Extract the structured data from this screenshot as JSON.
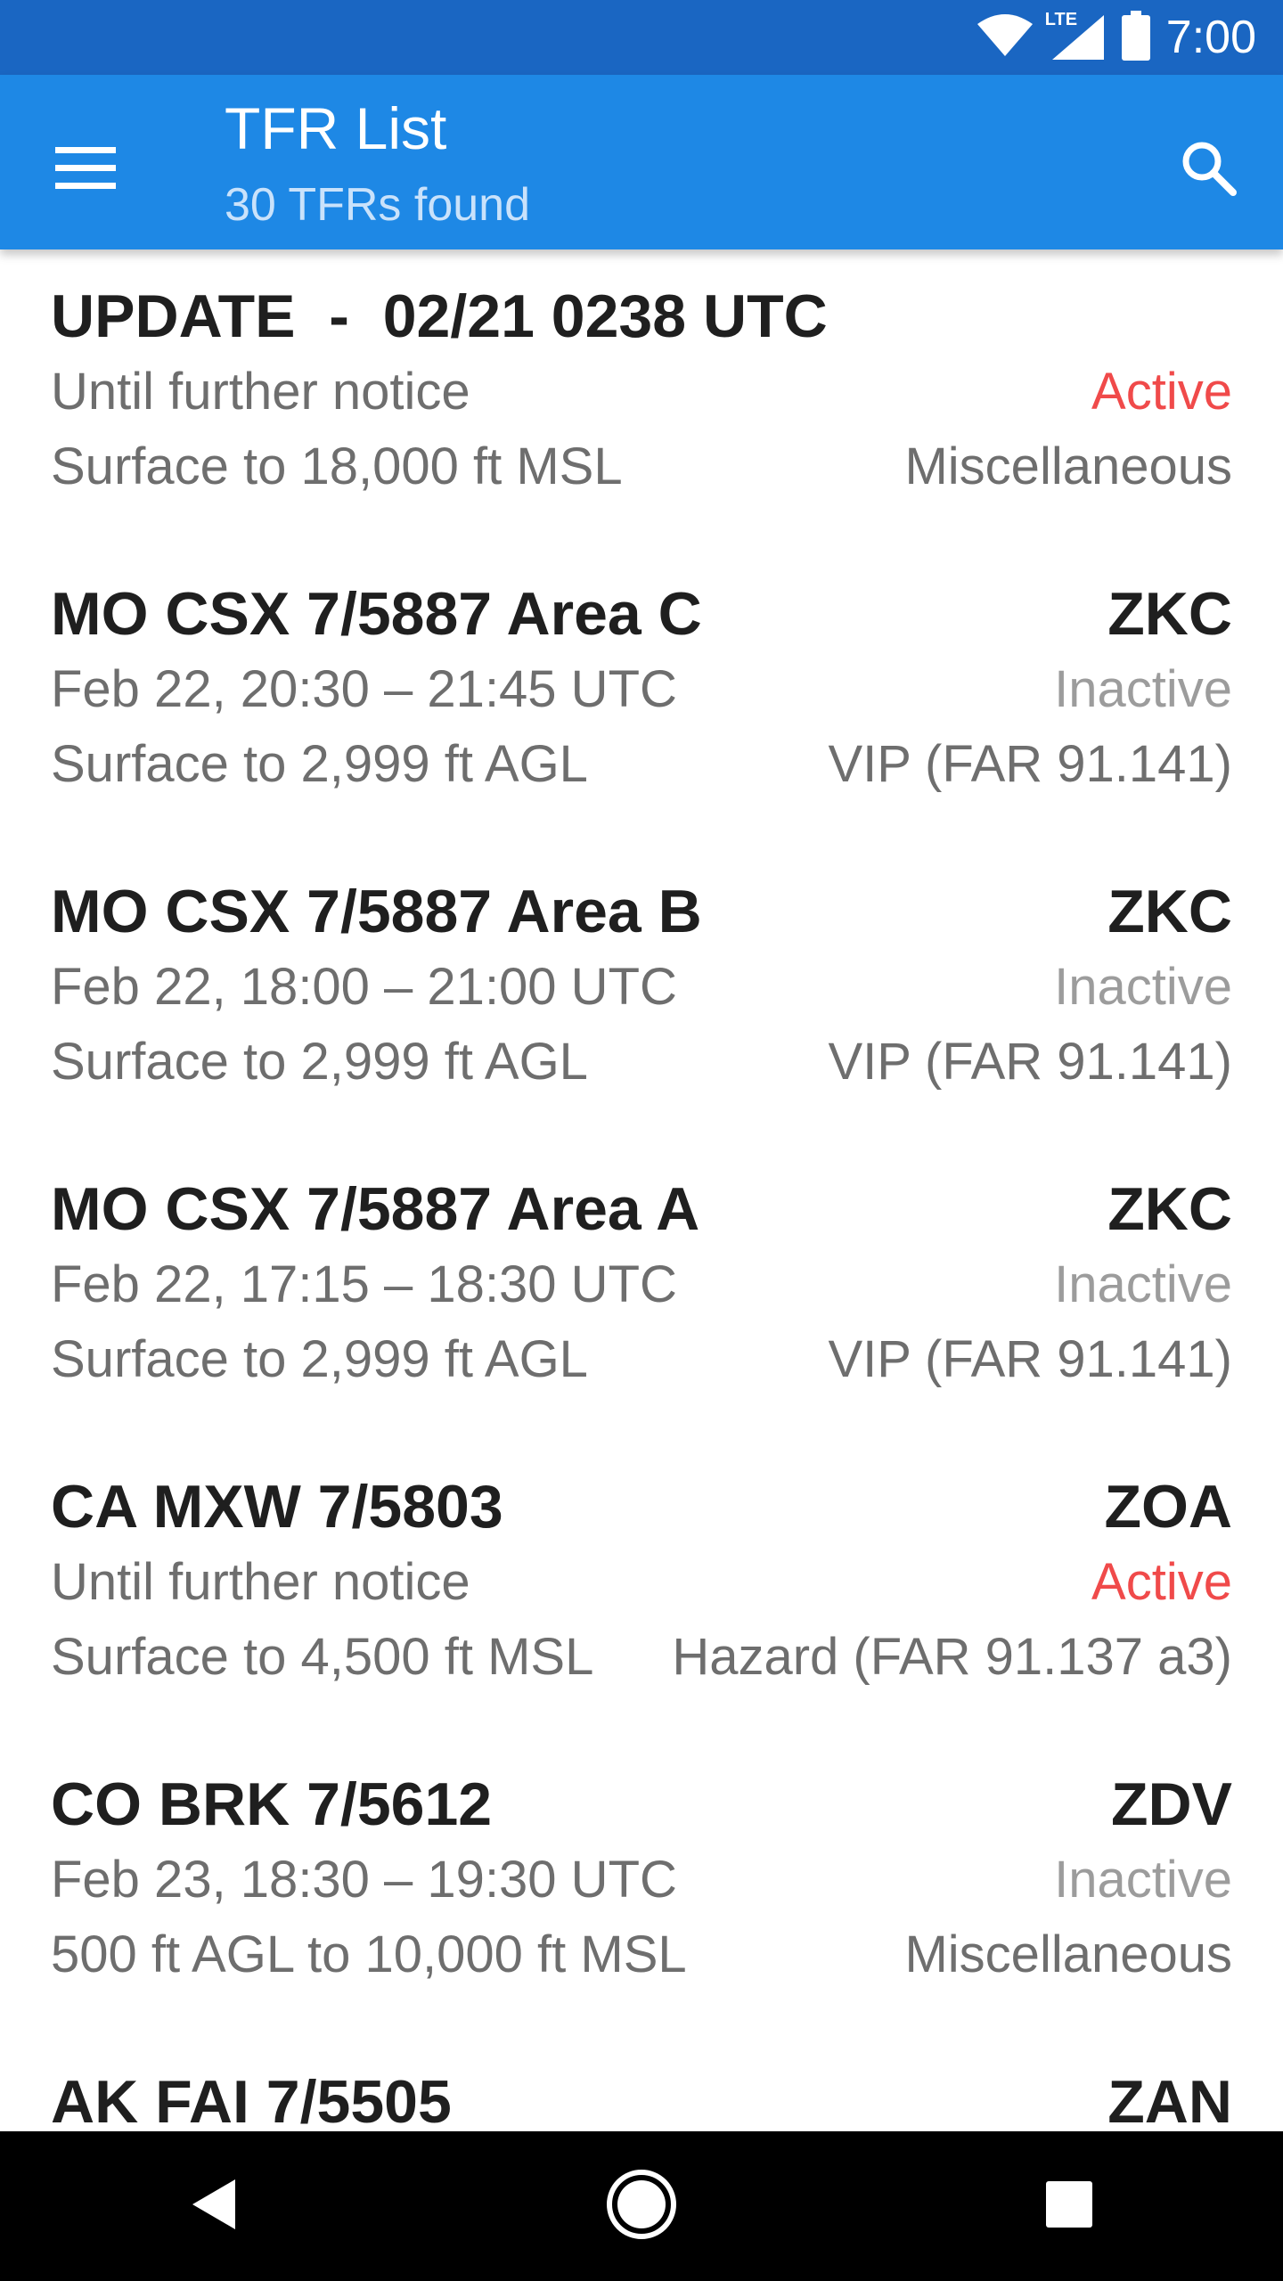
{
  "status_bar": {
    "time": "7:00",
    "network": "LTE",
    "icons": [
      "wifi-icon",
      "cell-signal-icon",
      "battery-icon"
    ]
  },
  "app_bar": {
    "title": "TFR List",
    "subtitle": "30 TFRs found",
    "menu_icon": "hamburger-menu-icon",
    "search_icon": "search-icon"
  },
  "colors": {
    "status_bar": "#1a66c2",
    "app_bar": "#1e88e5",
    "active": "#f04a4a",
    "inactive": "#9c9c9c"
  },
  "tfrs": [
    {
      "title": "UPDATE  -  02/21 0238 UTC",
      "center": "",
      "time": "Until further notice",
      "status": "Active",
      "altitude": "Surface to 18,000 ft MSL",
      "type": "Miscellaneous"
    },
    {
      "title": "MO CSX 7/5887 Area C",
      "center": "ZKC",
      "time": "Feb 22, 20:30 – 21:45 UTC",
      "status": "Inactive",
      "altitude": "Surface to 2,999 ft AGL",
      "type": "VIP (FAR 91.141)"
    },
    {
      "title": "MO CSX 7/5887 Area B",
      "center": "ZKC",
      "time": "Feb 22, 18:00 – 21:00 UTC",
      "status": "Inactive",
      "altitude": "Surface to 2,999 ft AGL",
      "type": "VIP (FAR 91.141)"
    },
    {
      "title": "MO CSX 7/5887 Area A",
      "center": "ZKC",
      "time": "Feb 22, 17:15 – 18:30 UTC",
      "status": "Inactive",
      "altitude": "Surface to 2,999 ft AGL",
      "type": "VIP (FAR 91.141)"
    },
    {
      "title": "CA MXW 7/5803",
      "center": "ZOA",
      "time": "Until further notice",
      "status": "Active",
      "altitude": "Surface to 4,500 ft MSL",
      "type": "Hazard (FAR 91.137 a3)"
    },
    {
      "title": "CO BRK 7/5612",
      "center": "ZDV",
      "time": "Feb 23, 18:30 – 19:30 UTC",
      "status": "Inactive",
      "altitude": "500 ft AGL to 10,000 ft MSL",
      "type": "Miscellaneous"
    },
    {
      "title": "AK FAI 7/5505",
      "center": "ZAN",
      "time": "",
      "status": "",
      "altitude": "",
      "type": ""
    }
  ],
  "nav_bar": {
    "buttons": [
      "back-icon",
      "home-icon",
      "recents-icon"
    ]
  }
}
